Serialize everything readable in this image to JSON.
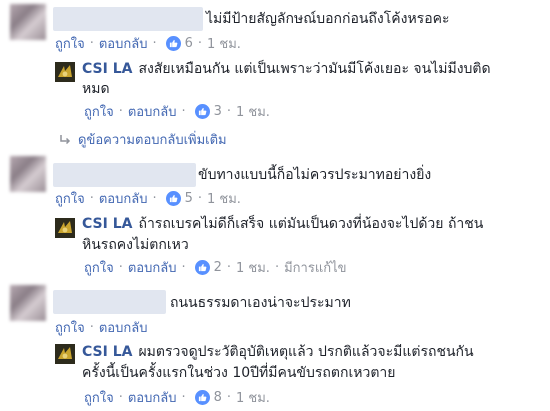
{
  "comments": [
    {
      "text": "ไม่มีป้ายสัญลักษณ์บอกก่อนถึงโค้งหรอคะ",
      "like_label": "ถูกใจ",
      "reply_label": "ตอบกลับ",
      "likes": "6",
      "time": "1 ชม."
    },
    {
      "text": "ขับทางแบบนี้ก็อไม่ควรประมาทอย่างยิ่ง",
      "like_label": "ถูกใจ",
      "reply_label": "ตอบกลับ",
      "likes": "5",
      "time": "1 ชม."
    },
    {
      "text": "ถนนธรรมดาเองน่าจะประมาท",
      "like_label": "ถูกใจ",
      "reply_label": "ตอบกลับ",
      "likes": "",
      "time": ""
    }
  ],
  "replies": [
    {
      "author": "CSI LA",
      "line1": "สงสัยเหมือนกัน แต่เป็นเพราะว่ามันมีโค้งเยอะ จนไม่มีงบติด",
      "line2": "หมด",
      "like_label": "ถูกใจ",
      "reply_label": "ตอบกลับ",
      "likes": "3",
      "time": "1 ชม."
    },
    {
      "author": "CSI LA",
      "line1": "ถ้ารถเบรคไม่ดีก็เสร็จ แต่มันเป็นดวงที่น้องจะไปด้วย ถ้าชน",
      "line2": "หินรถคงไม่ตกเหว",
      "like_label": "ถูกใจ",
      "reply_label": "ตอบกลับ",
      "likes": "2",
      "time": "1 ชม.",
      "edited": "มีการแก้ไข"
    },
    {
      "author": "CSI LA",
      "line1": "ผมตรวจดูประวัติอุบัติเหตุแล้ว ปรกติแล้วจะมีแต่รถชนกัน",
      "line2": "ครั้งนี้เป็นครั้งแรกในช่วง 10ปีที่มีคนขับรถตกเหวตาย",
      "like_label": "ถูกใจ",
      "reply_label": "ตอบกลับ",
      "likes": "8",
      "time": "1 ชม."
    }
  ],
  "more_replies_label": "ดูข้อความตอบกลับเพิ่มเติม",
  "colors": {
    "link": "#4267b2",
    "author": "#365899",
    "like_badge": "#5890ff",
    "meta": "#90949c"
  }
}
